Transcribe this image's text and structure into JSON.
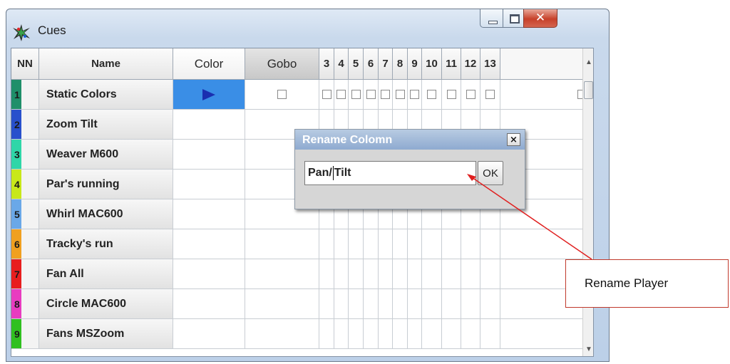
{
  "window": {
    "title": "Cues"
  },
  "headers": {
    "nn": "NN",
    "name": "Name",
    "color": "Color",
    "gobo": "Gobo",
    "numbers": [
      "3",
      "4",
      "5",
      "6",
      "7",
      "8",
      "9",
      "10",
      "11",
      "12",
      "13"
    ]
  },
  "rows": [
    {
      "nn": "1",
      "name": "Static Colors",
      "color": "#1f8f6a"
    },
    {
      "nn": "2",
      "name": "Zoom Tilt",
      "color": "#2850cc"
    },
    {
      "nn": "3",
      "name": "Weaver M600",
      "color": "#2fd6a8"
    },
    {
      "nn": "4",
      "name": "Par's running",
      "color": "#c8e81a"
    },
    {
      "nn": "5",
      "name": "Whirl MAC600",
      "color": "#6aa8e8"
    },
    {
      "nn": "6",
      "name": "Tracky's run",
      "color": "#f0a020"
    },
    {
      "nn": "7",
      "name": "Fan All",
      "color": "#e81e1e"
    },
    {
      "nn": "8",
      "name": "Circle MAC600",
      "color": "#e83cc0"
    },
    {
      "nn": "9",
      "name": "Fans MSZoom",
      "color": "#30c020"
    }
  ],
  "dialog": {
    "title": "Rename Colomn",
    "value_before": "Pan/",
    "value_after": "Tilt",
    "ok_label": "OK",
    "close_label": "×"
  },
  "annotation": {
    "label": "Rename Player"
  },
  "colors": {
    "accent_cell": "#3a8ee6",
    "annotation_line": "#e02020"
  }
}
